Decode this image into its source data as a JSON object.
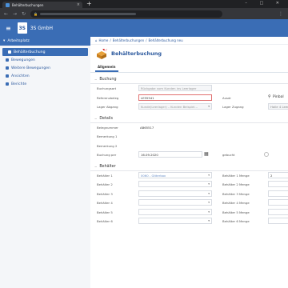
{
  "browser": {
    "tab_title": "Behälterbuchungen",
    "new_tab": "+",
    "window_controls": "– □ ✕"
  },
  "app": {
    "company": "3S GmbH",
    "logo_text": "3S"
  },
  "sidebar": {
    "header": "Arbeitsplatz",
    "items": [
      {
        "label": "Behälterbuchung",
        "active": true
      },
      {
        "label": "Bewegungen"
      },
      {
        "label": "Weitere Bewegungen"
      },
      {
        "label": "Ansichten"
      },
      {
        "label": "Berichte"
      }
    ]
  },
  "breadcrumb": {
    "home": "Home",
    "sep": "/",
    "level1": "Behälterbuchungen",
    "level2": "Behälterbuchung neu"
  },
  "page": {
    "title": "Behälterbuchung",
    "tab": "Allgemein"
  },
  "sections": {
    "buchung": "Buchung",
    "details": "Details",
    "behaelter": "Behälter"
  },
  "buchung": {
    "buchungsart_label": "Buchungsart",
    "buchungsart_value": "Rückgabe vom Kunden ins Leerlager",
    "referenzbeleg_label": "Referenzbeleg",
    "referenzbeleg_value": "LE55541",
    "ausdr_label": "Ausdr",
    "pin_label": "Pinbal",
    "lager_abgang_label": "Lager Abgang",
    "lager_abgang_value": "Kunde(Leerlager) – Kunden Beispiel...",
    "lager_zugang_label": "Lager Zugang",
    "lager_zugang_value": "Halle 4 Leer"
  },
  "details": {
    "belegnummer_label": "Belegnummer",
    "belegnummer_value": "AB65517",
    "bemerkung1_label": "Bemerkung 1",
    "bemerkung2_label": "Bemerkung 2",
    "buchung_per_label": "Buchung per",
    "buchung_per_value": "16.09.2020",
    "gebucht_label": "gebucht"
  },
  "behaelter": {
    "rows": [
      {
        "label": "Behälter 1",
        "value": "0060 - Gitterbox",
        "menge_label": "Behälter 1 Menge",
        "menge_value": "2"
      },
      {
        "label": "Behälter 2",
        "value": "",
        "menge_label": "Behälter 2 Menge",
        "menge_value": ""
      },
      {
        "label": "Behälter 3",
        "value": "",
        "menge_label": "Behälter 3 Menge",
        "menge_value": ""
      },
      {
        "label": "Behälter 4",
        "value": "",
        "menge_label": "Behälter 4 Menge",
        "menge_value": ""
      },
      {
        "label": "Behälter 5",
        "value": "",
        "menge_label": "Behälter 5 Menge",
        "menge_value": ""
      },
      {
        "label": "Behälter 6",
        "value": "",
        "menge_label": "Behälter 6 Menge",
        "menge_value": ""
      }
    ]
  },
  "colors": {
    "primary": "#3a6db5",
    "browser_dark": "#202124"
  }
}
